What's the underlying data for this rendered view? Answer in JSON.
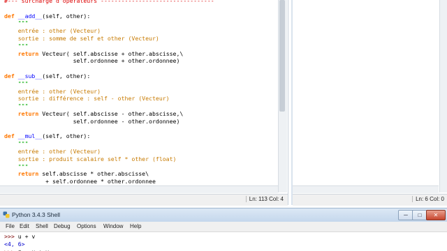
{
  "editor": {
    "lines": [
      [
        {
          "t": "#--- surcharge d'opérateurs ---------------------------------",
          "c": "cmt"
        }
      ],
      [
        {
          "t": "",
          "c": "plain"
        }
      ],
      [
        {
          "t": "def ",
          "c": "kw"
        },
        {
          "t": "__add__",
          "c": "fn"
        },
        {
          "t": "(self, other):",
          "c": "plain"
        }
      ],
      [
        {
          "t": "    \"\"\"",
          "c": "str"
        }
      ],
      [
        {
          "t": "    entrée : other (Vecteur)",
          "c": "fr"
        }
      ],
      [
        {
          "t": "    sortie : somme de self et other (Vecteur)",
          "c": "fr"
        }
      ],
      [
        {
          "t": "    \"\"\"",
          "c": "str"
        }
      ],
      [
        {
          "t": "    return ",
          "c": "kw"
        },
        {
          "t": "Vecteur( self.abscisse + other.abscisse,\\",
          "c": "plain"
        }
      ],
      [
        {
          "t": "                    self.ordonnee + other.ordonnee)",
          "c": "plain"
        }
      ],
      [
        {
          "t": "",
          "c": "plain"
        }
      ],
      [
        {
          "t": "def ",
          "c": "kw"
        },
        {
          "t": "__sub__",
          "c": "fn"
        },
        {
          "t": "(self, other):",
          "c": "plain"
        }
      ],
      [
        {
          "t": "    \"\"\"",
          "c": "str"
        }
      ],
      [
        {
          "t": "    entrée : other (Vecteur)",
          "c": "fr"
        }
      ],
      [
        {
          "t": "    sortie : différence : self - other (Vecteur)",
          "c": "fr"
        }
      ],
      [
        {
          "t": "    \"\"\"",
          "c": "str"
        }
      ],
      [
        {
          "t": "    return ",
          "c": "kw"
        },
        {
          "t": "Vecteur( self.abscisse - other.abscisse,\\",
          "c": "plain"
        }
      ],
      [
        {
          "t": "                    self.ordonnee - other.ordonnee)",
          "c": "plain"
        }
      ],
      [
        {
          "t": "",
          "c": "plain"
        }
      ],
      [
        {
          "t": "def ",
          "c": "kw"
        },
        {
          "t": "__mul__",
          "c": "fn"
        },
        {
          "t": "(self, other):",
          "c": "plain"
        }
      ],
      [
        {
          "t": "    \"\"\"",
          "c": "str"
        }
      ],
      [
        {
          "t": "    entrée : other (Vecteur)",
          "c": "fr"
        }
      ],
      [
        {
          "t": "    sortie : produit scalaire self * other (float)",
          "c": "fr"
        }
      ],
      [
        {
          "t": "    \"\"\"",
          "c": "str"
        }
      ],
      [
        {
          "t": "    return ",
          "c": "kw"
        },
        {
          "t": "self.abscisse * other.abscisse\\",
          "c": "plain"
        }
      ],
      [
        {
          "t": "            + self.ordonnee * other.ordonnee",
          "c": "plain"
        }
      ]
    ],
    "status_position": "Ln: 113  Col: 4"
  },
  "editor2": {
    "status_position": "Ln: 6  Col: 0"
  },
  "shell": {
    "title": "Python 3.4.3 Shell",
    "menu": [
      "File",
      "Edit",
      "Shell",
      "Debug",
      "Options",
      "Window",
      "Help"
    ],
    "buttons": {
      "minimize": "─",
      "maximize": "□",
      "close": "✕"
    },
    "lines": [
      [
        {
          "t": ">>> ",
          "c": "prompt"
        },
        {
          "t": "u + v",
          "c": "plain"
        }
      ],
      [
        {
          "t": "<4, 6>",
          "c": "out"
        }
      ],
      [
        {
          "t": ">>> ",
          "c": "prompt"
        },
        {
          "t": "z = u + v",
          "c": "plain"
        }
      ]
    ]
  },
  "colors": {
    "keyword": "#ff7700",
    "builtin": "#0000ff",
    "string": "#00aa00",
    "comment": "#dd0000",
    "shell_output": "#0000cc"
  }
}
